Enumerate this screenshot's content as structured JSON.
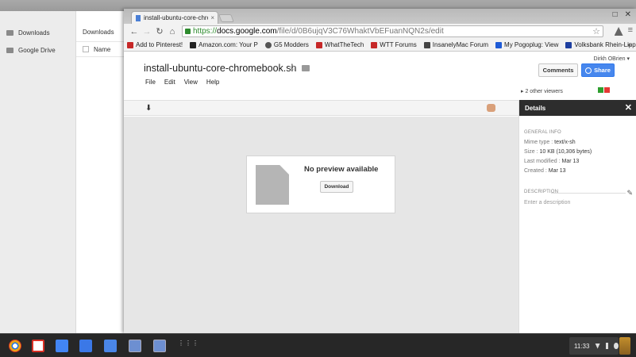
{
  "files_app": {
    "sidebar": [
      {
        "label": "Downloads",
        "icon": "folder-icon"
      },
      {
        "label": "Google Drive",
        "icon": "drive-icon"
      }
    ],
    "title": "Downloads",
    "column_name": "Name"
  },
  "browser": {
    "tab_title": "install-ubuntu-core-chrom",
    "tab_close": "×",
    "window_controls": [
      "□",
      "✕"
    ],
    "url": {
      "scheme": "https://",
      "host": "docs.google.com",
      "path": "/file/d/0B6ujqV3C76WhaktVbEFuanNQN2s/edit"
    },
    "bookmarks": [
      {
        "label": "Add to Pinterest!",
        "color": "#c62828"
      },
      {
        "label": "Amazon.com: Your P",
        "color": "#222222"
      },
      {
        "label": "G5 Modders",
        "color": "#555555"
      },
      {
        "label": "WhatTheTech",
        "color": "#c62828"
      },
      {
        "label": "WTT Forums",
        "color": "#c62828"
      },
      {
        "label": "InsanelyMac Forum",
        "color": "#444444"
      },
      {
        "label": "My Pogoplug: View",
        "color": "#1e5bd6"
      },
      {
        "label": "Volksbank Rhein-Lipp",
        "color": "#1e3fa0"
      }
    ],
    "bookmarks_more": "»"
  },
  "docs": {
    "title": "install-ubuntu-core-chromebook.sh",
    "menu": [
      "File",
      "Edit",
      "View",
      "Help"
    ],
    "user_name": "Dirkh OBrien",
    "comments_label": "Comments",
    "share_label": "Share",
    "viewers_text": "2 other viewers",
    "viewer_colors": [
      "#2e9e2e",
      "#e53935"
    ],
    "no_preview_text": "No preview available",
    "download_label": "Download"
  },
  "details": {
    "header": "Details",
    "general_info_label": "GENERAL INFO",
    "mime_key": "Mime type :",
    "mime_val": "text/x-sh",
    "size_key": "Size :",
    "size_val": "10 KB (10,306 bytes)",
    "modified_key": "Last modified :",
    "modified_val": "Mar 13",
    "created_key": "Created :",
    "created_val": "Mar 13",
    "description_label": "DESCRIPTION",
    "description_placeholder": "Enter a description"
  },
  "shelf": {
    "apps": [
      {
        "name": "chrome",
        "color": "#e8a317"
      },
      {
        "name": "gmail",
        "color": "#d93025"
      },
      {
        "name": "files",
        "color": "#4285f4"
      },
      {
        "name": "google-search",
        "color": "#3b78e7"
      },
      {
        "name": "calendar",
        "color": "#4a86e8"
      },
      {
        "name": "files-window",
        "color": "#6d8fd1"
      },
      {
        "name": "docs-window",
        "color": "#6d8fd1"
      }
    ],
    "launcher": "⋮⋮⋮",
    "time": "11:33"
  }
}
